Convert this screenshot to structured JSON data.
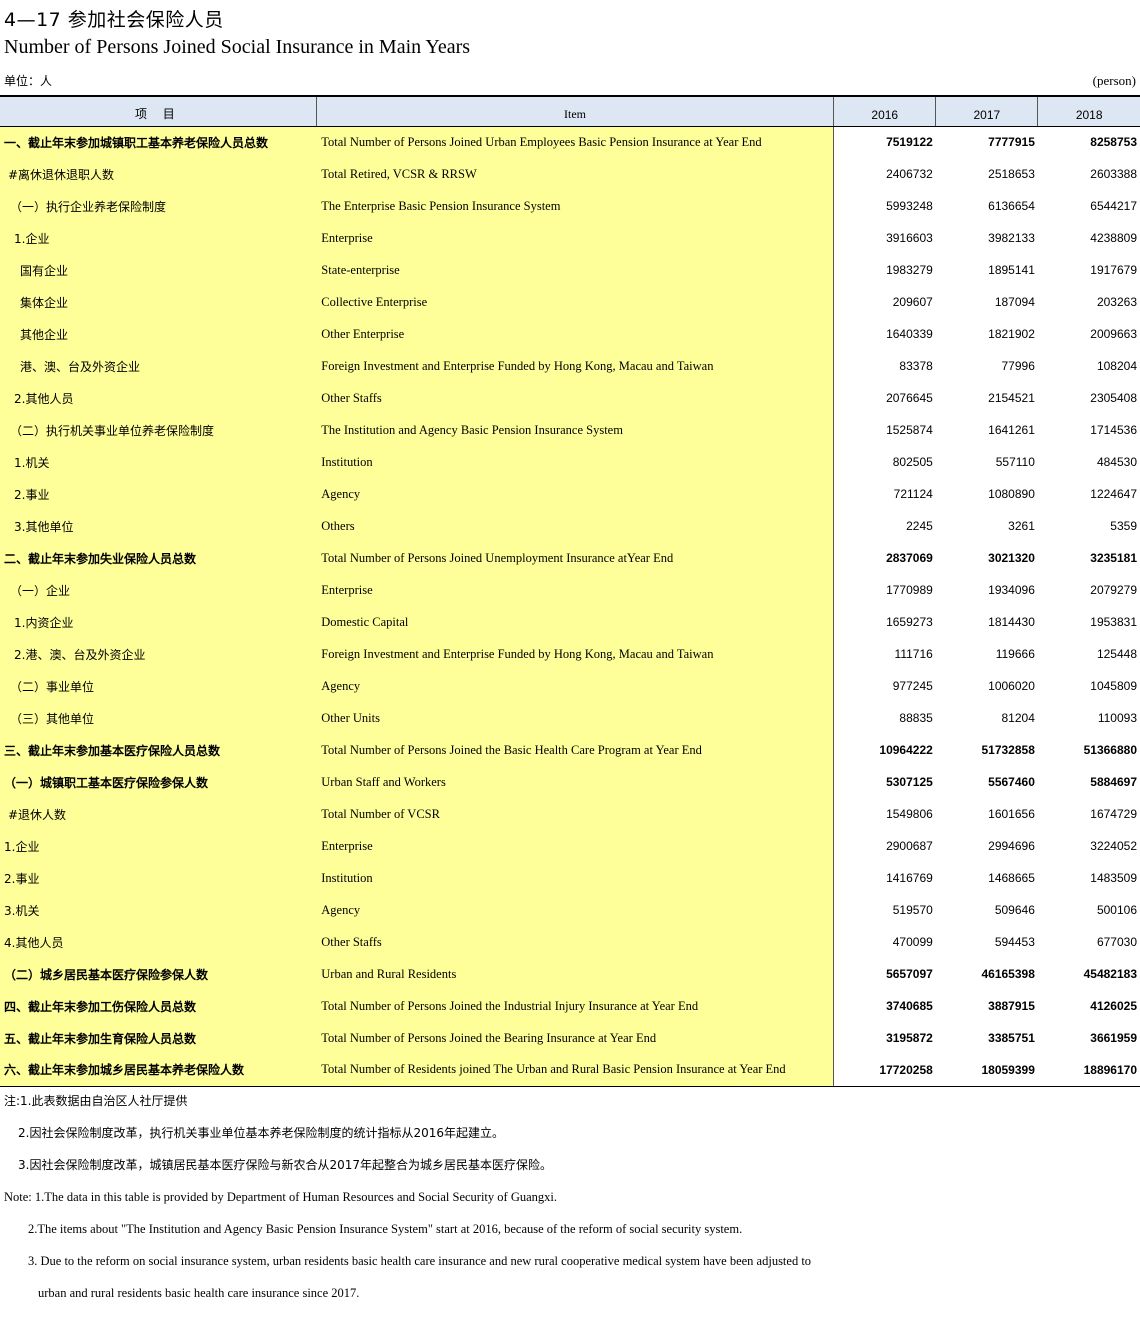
{
  "title_cn": "4—17  参加社会保险人员",
  "title_en": "Number of Persons Joined Social Insurance in Main Years",
  "unit_cn": "单位：人",
  "unit_en": "(person)",
  "header": {
    "item_cn": "项  目",
    "item_en": "Item",
    "years": [
      "2016",
      "2017",
      "2018"
    ]
  },
  "rows": [
    {
      "cn": "一、截止年末参加城镇职工基本养老保险人员总数",
      "en": "Total Number of Persons Joined Urban Employees Basic Pension Insurance at Year End",
      "values": [
        "7519122",
        "7777915",
        "8258753"
      ],
      "bold": true,
      "indent": 0
    },
    {
      "cn": "#离休退休退职人数",
      "en": "Total Retired, VCSR & RRSW",
      "values": [
        "2406732",
        "2518653",
        "2603388"
      ],
      "bold": false,
      "indent": 4
    },
    {
      "cn": "（一）执行企业养老保险制度",
      "en": "The Enterprise Basic Pension Insurance System",
      "values": [
        "5993248",
        "6136654",
        "6544217"
      ],
      "bold": false,
      "indent": 1
    },
    {
      "cn": "1.企业",
      "en": "Enterprise",
      "values": [
        "3916603",
        "3982133",
        "4238809"
      ],
      "bold": false,
      "indent": 2
    },
    {
      "cn": "国有企业",
      "en": "State-enterprise",
      "values": [
        "1983279",
        "1895141",
        "1917679"
      ],
      "bold": false,
      "indent": 3
    },
    {
      "cn": "集体企业",
      "en": "Collective Enterprise",
      "values": [
        "209607",
        "187094",
        "203263"
      ],
      "bold": false,
      "indent": 3
    },
    {
      "cn": "其他企业",
      "en": "Other Enterprise",
      "values": [
        "1640339",
        "1821902",
        "2009663"
      ],
      "bold": false,
      "indent": 3
    },
    {
      "cn": "港、澳、台及外资企业",
      "en": "Foreign Investment and Enterprise Funded by Hong Kong, Macau and Taiwan",
      "values": [
        "83378",
        "77996",
        "108204"
      ],
      "bold": false,
      "indent": 3
    },
    {
      "cn": "2.其他人员",
      "en": "Other Staffs",
      "values": [
        "2076645",
        "2154521",
        "2305408"
      ],
      "bold": false,
      "indent": 2
    },
    {
      "cn": "（二）执行机关事业单位养老保险制度",
      "en": "The Institution and Agency Basic Pension Insurance System",
      "values": [
        "1525874",
        "1641261",
        "1714536"
      ],
      "bold": false,
      "indent": 1
    },
    {
      "cn": "1.机关",
      "en": "Institution",
      "values": [
        "802505",
        "557110",
        "484530"
      ],
      "bold": false,
      "indent": 2
    },
    {
      "cn": "2.事业",
      "en": "Agency",
      "values": [
        "721124",
        "1080890",
        "1224647"
      ],
      "bold": false,
      "indent": 2
    },
    {
      "cn": "3.其他单位",
      "en": "Others",
      "values": [
        "2245",
        "3261",
        "5359"
      ],
      "bold": false,
      "indent": 2
    },
    {
      "cn": "二、截止年末参加失业保险人员总数",
      "en": "Total Number of Persons Joined Unemployment Insurance atYear End",
      "values": [
        "2837069",
        "3021320",
        "3235181"
      ],
      "bold": true,
      "indent": 0
    },
    {
      "cn": "（一）企业",
      "en": "Enterprise",
      "values": [
        "1770989",
        "1934096",
        "2079279"
      ],
      "bold": false,
      "indent": 1
    },
    {
      "cn": "1.内资企业",
      "en": "Domestic Capital",
      "values": [
        "1659273",
        "1814430",
        "1953831"
      ],
      "bold": false,
      "indent": 2
    },
    {
      "cn": "2.港、澳、台及外资企业",
      "en": "Foreign Investment and Enterprise Funded by Hong Kong, Macau and Taiwan",
      "values": [
        "111716",
        "119666",
        "125448"
      ],
      "bold": false,
      "indent": 2
    },
    {
      "cn": "（二）事业单位",
      "en": "Agency",
      "values": [
        "977245",
        "1006020",
        "1045809"
      ],
      "bold": false,
      "indent": 1
    },
    {
      "cn": "（三）其他单位",
      "en": "Other Units",
      "values": [
        "88835",
        "81204",
        "110093"
      ],
      "bold": false,
      "indent": 1
    },
    {
      "cn": "三、截止年末参加基本医疗保险人员总数",
      "en": "Total Number of Persons Joined the  Basic Health Care Program at Year End",
      "values": [
        "10964222",
        "51732858",
        "51366880"
      ],
      "bold": true,
      "indent": 0
    },
    {
      "cn": "（一）城镇职工基本医疗保险参保人数",
      "en": "Urban Staff and Workers",
      "values": [
        "5307125",
        "5567460",
        "5884697"
      ],
      "bold": true,
      "indent": 0
    },
    {
      "cn": "#退休人数",
      "en": "Total Number of VCSR",
      "values": [
        "1549806",
        "1601656",
        "1674729"
      ],
      "bold": false,
      "indent": 4
    },
    {
      "cn": "1.企业",
      "en": "Enterprise",
      "values": [
        "2900687",
        "2994696",
        "3224052"
      ],
      "bold": false,
      "indent": 0
    },
    {
      "cn": "2.事业",
      "en": "Institution",
      "values": [
        "1416769",
        "1468665",
        "1483509"
      ],
      "bold": false,
      "indent": 0
    },
    {
      "cn": "3.机关",
      "en": "Agency",
      "values": [
        "519570",
        "509646",
        "500106"
      ],
      "bold": false,
      "indent": 0
    },
    {
      "cn": "4.其他人员",
      "en": "Other Staffs",
      "values": [
        "470099",
        "594453",
        "677030"
      ],
      "bold": false,
      "indent": 0
    },
    {
      "cn": "（二）城乡居民基本医疗保险参保人数",
      "en": " Urban and Rural Residents",
      "values": [
        "5657097",
        "46165398",
        "45482183"
      ],
      "bold": true,
      "indent": 0
    },
    {
      "cn": "四、截止年末参加工伤保险人员总数",
      "en": "Total Number of Persons Joined the Industrial Injury Insurance at Year End",
      "values": [
        "3740685",
        "3887915",
        "4126025"
      ],
      "bold": true,
      "indent": 0
    },
    {
      "cn": "五、截止年末参加生育保险人员总数",
      "en": "Total Number of Persons Joined the Bearing Insurance at Year End",
      "values": [
        "3195872",
        "3385751",
        "3661959"
      ],
      "bold": true,
      "indent": 0
    },
    {
      "cn": "六、截止年末参加城乡居民基本养老保险人数",
      "en": "Total Number of Residents joined The Urban and Rural Basic Pension Insurance at Year End",
      "values": [
        "17720258",
        "18059399",
        "18896170"
      ],
      "bold": true,
      "indent": 0
    }
  ],
  "notes": [
    {
      "text": "注:1.此表数据由自治区人社厅提供",
      "lang": "cn",
      "indent": 0
    },
    {
      "text": "2.因社会保险制度改革，执行机关事业单位基本养老保险制度的统计指标从2016年起建立。",
      "lang": "cn",
      "indent": 1
    },
    {
      "text": "3.因社会保险制度改革，城镇居民基本医疗保险与新农合从2017年起整合为城乡居民基本医疗保险。",
      "lang": "cn",
      "indent": 1
    },
    {
      "text": "Note: 1.The data in this table is provided by Department of Human Resources and Social Security of Guangxi.",
      "lang": "en",
      "indent": 0
    },
    {
      "text": "2.The items about \"The Institution and Agency Basic Pension Insurance System\" start at 2016, because of the reform of social security system.",
      "lang": "en",
      "indent": 2
    },
    {
      "text": "3. Due to the reform on social insurance system, urban residents basic health care insurance and new rural cooperative medical system have been adjusted to",
      "lang": "en",
      "indent": 2
    },
    {
      "text": "urban and rural residents basic health care insurance since 2017.",
      "lang": "en",
      "indent": 3
    }
  ]
}
